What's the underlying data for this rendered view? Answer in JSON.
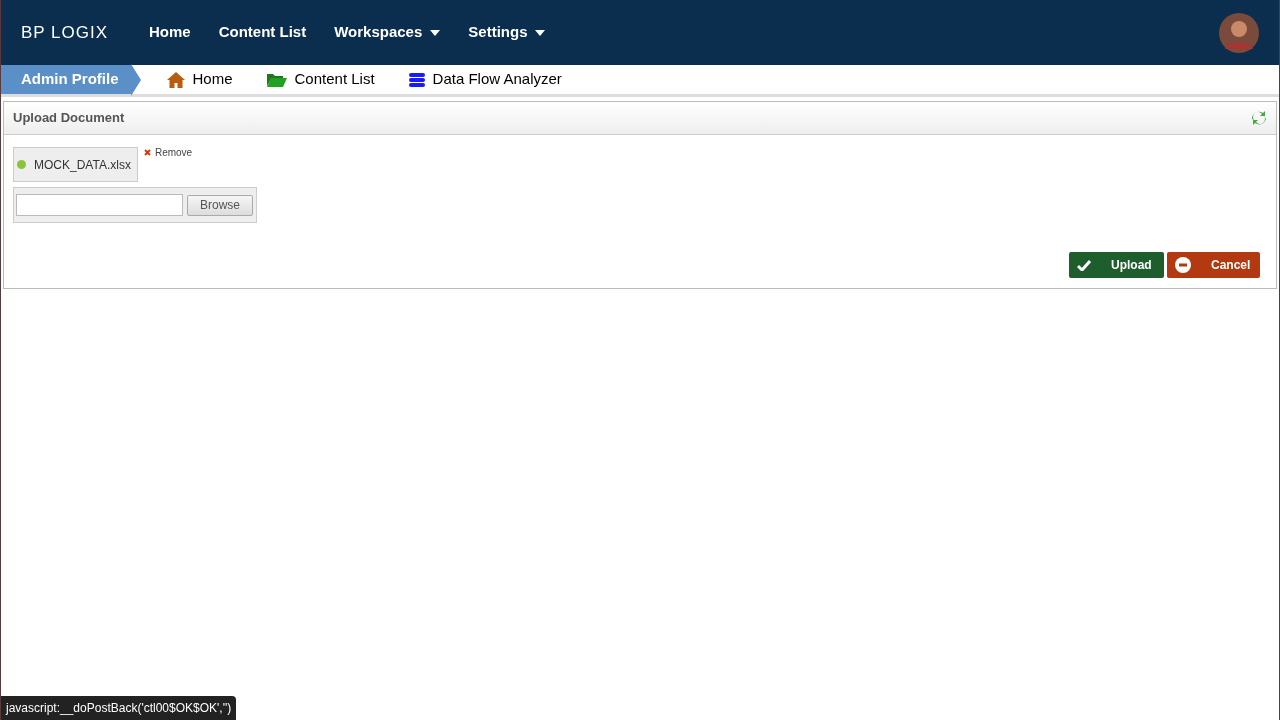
{
  "logo": "BP LOGIX",
  "nav": [
    {
      "label": "Home",
      "dropdown": false
    },
    {
      "label": "Content List",
      "dropdown": false
    },
    {
      "label": "Workspaces",
      "dropdown": true
    },
    {
      "label": "Settings",
      "dropdown": true
    }
  ],
  "breadcrumb": {
    "current": "Admin Profile",
    "links": [
      {
        "label": "Home",
        "kind": "home"
      },
      {
        "label": "Content List",
        "kind": "folder"
      },
      {
        "label": "Data Flow Analyzer",
        "kind": "database"
      }
    ]
  },
  "panel": {
    "title": "Upload Document",
    "file": {
      "name": "MOCK_DATA.xlsx",
      "remove": "Remove"
    },
    "browse": "Browse",
    "buttons": [
      {
        "label": "Upload",
        "kind": "ok"
      },
      {
        "label": "Cancel",
        "kind": "cancel"
      }
    ]
  },
  "status_text": "javascript:__doPostBack('ctl00$OK$OK','')"
}
